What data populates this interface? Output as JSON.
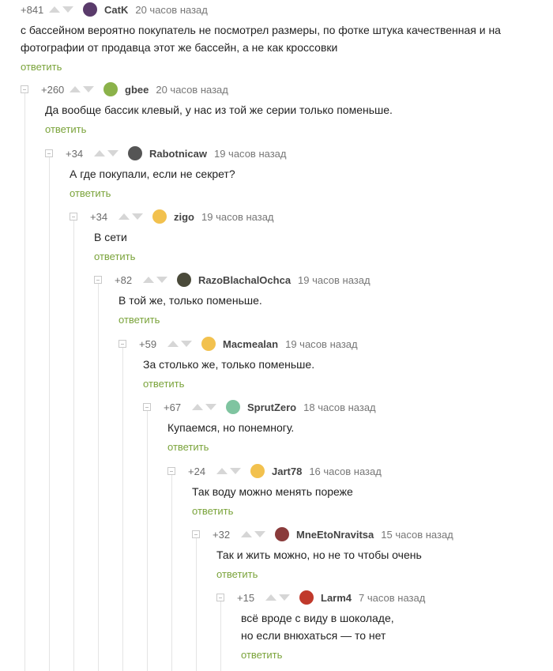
{
  "reply_label": "ответить",
  "comments": [
    {
      "rating": "+841",
      "author": "CatK",
      "time": "20 часов назад",
      "avatar_color": "#5a3b6b",
      "lines": [
        "с бассейном вероятно покупатель не посмотрел размеры, по фотке штука качественная и на",
        "фотографии от продавца этот же бассейн, а не как кроссовки"
      ]
    },
    {
      "rating": "+260",
      "author": "gbee",
      "time": "20 часов назад",
      "avatar_color": "#8bb24a",
      "lines": [
        "Да вообще бассик клевый, у нас из той же серии только поменьше."
      ]
    },
    {
      "rating": "+34",
      "author": "Rabotnicaw",
      "time": "19 часов назад",
      "avatar_color": "#555555",
      "lines": [
        "А где покупали, если не секрет?"
      ]
    },
    {
      "rating": "+34",
      "author": "zigo",
      "time": "19 часов назад",
      "avatar_color": "#f2c14e",
      "lines": [
        "В сети"
      ]
    },
    {
      "rating": "+82",
      "author": "RazoBlachalOchca",
      "time": "19 часов назад",
      "avatar_color": "#4a4a3a",
      "lines": [
        "В той же, только поменьше."
      ]
    },
    {
      "rating": "+59",
      "author": "Macmealan",
      "time": "19 часов назад",
      "avatar_color": "#f2c14e",
      "lines": [
        "За столько же, только поменьше."
      ]
    },
    {
      "rating": "+67",
      "author": "SprutZero",
      "time": "18 часов назад",
      "avatar_color": "#7fc4a0",
      "lines": [
        "Купаемся, но понемногу."
      ]
    },
    {
      "rating": "+24",
      "author": "Jart78",
      "time": "16 часов назад",
      "avatar_color": "#f2c14e",
      "lines": [
        "Так воду можно менять пореже"
      ]
    },
    {
      "rating": "+32",
      "author": "MneEtoNravitsa",
      "time": "15 часов назад",
      "avatar_color": "#8a3b3b",
      "lines": [
        "Так и жить можно, но не то чтобы очень"
      ]
    },
    {
      "rating": "+15",
      "author": "Larm4",
      "time": "7 часов назад",
      "avatar_color": "#c0392b",
      "lines": [
        "всё вроде с виду в шоколаде,",
        "но если внюхаться — то нет"
      ]
    }
  ]
}
